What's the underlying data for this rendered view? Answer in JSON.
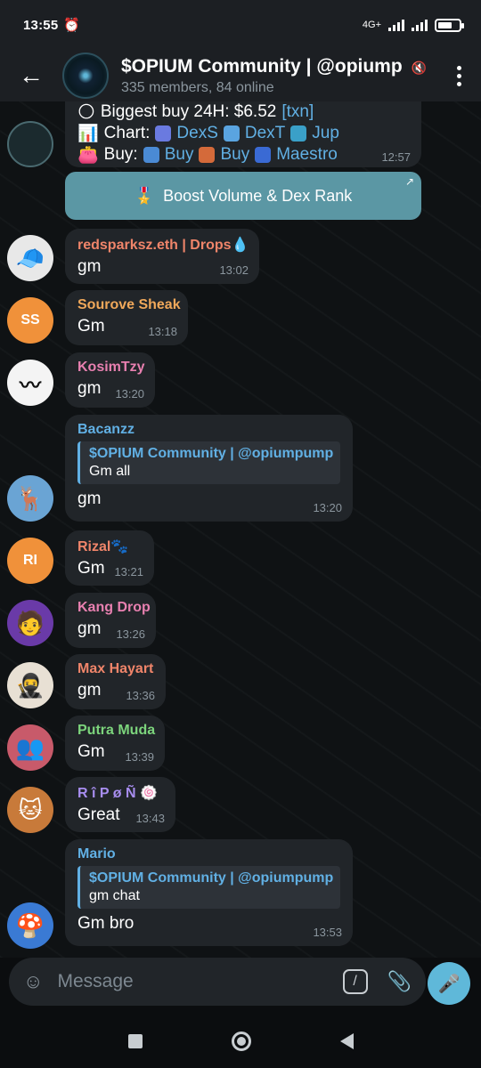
{
  "status_bar": {
    "time": "13:55",
    "network": "4G+"
  },
  "header": {
    "back_label": "←",
    "title": "$OPIUM Community | @opiump",
    "subtitle": "335 members, 84 online"
  },
  "bot_message": {
    "biggest_buy": "Biggest buy 24H: $6.52",
    "txn_link": "[txn]",
    "chart_label": "Chart:",
    "chart_links": [
      "DexS",
      "DexT",
      "Jup"
    ],
    "buy_label": "Buy:",
    "buy_links": [
      "Buy",
      "Buy",
      "Maestro"
    ],
    "time": "12:57"
  },
  "boost_button": {
    "label": "Boost Volume & Dex Rank"
  },
  "messages": [
    {
      "name": "redsparksz.eth | Drops💧",
      "text": "gm",
      "time": "13:02",
      "name_color": "#f0856a",
      "avatar_initials": "",
      "avatar_color": "#e8e8e8"
    },
    {
      "name": "Sourove Sheak",
      "text": "Gm",
      "time": "13:18",
      "name_color": "#f0a85a",
      "avatar_initials": "SS",
      "avatar_color": "#f0913a"
    },
    {
      "name": "KosimTzy",
      "text": "gm",
      "time": "13:20",
      "name_color": "#e880b0",
      "avatar_initials": "",
      "avatar_color": "#f4f4f4"
    },
    {
      "name": "Bacanzz",
      "reply_name": "$OPIUM Community | @opiumpump",
      "reply_text": "Gm all",
      "text": "gm",
      "time": "13:20",
      "name_color": "#61b0e4",
      "avatar_initials": "",
      "avatar_color": "#6aa4d4"
    },
    {
      "name": "Rizal🐾",
      "text": "Gm",
      "time": "13:21",
      "name_color": "#f0856a",
      "avatar_initials": "RI",
      "avatar_color": "#f0913a"
    },
    {
      "name": "Kang Drop",
      "text": "gm",
      "time": "13:26",
      "name_color": "#e880b0",
      "avatar_initials": "",
      "avatar_color": "#6a3aa8"
    },
    {
      "name": "Max Hayart",
      "text": "gm",
      "time": "13:36",
      "name_color": "#f0856a",
      "avatar_initials": "",
      "avatar_color": "#e8e0d4"
    },
    {
      "name": "Putra Muda",
      "text": "Gm",
      "time": "13:39",
      "name_color": "#7cd47c",
      "avatar_initials": "",
      "avatar_color": "#c85a6a"
    },
    {
      "name": "R î P ø Ñ 🍥",
      "text": "Great",
      "time": "13:43",
      "name_color": "#a88ef0",
      "avatar_initials": "",
      "avatar_color": "#c87a3a"
    },
    {
      "name": "Mario",
      "reply_name": "$OPIUM Community | @opiumpump",
      "reply_text": "gm chat",
      "text": "Gm bro",
      "time": "13:53",
      "name_color": "#61b0e4",
      "avatar_initials": "",
      "avatar_color": "#3a7ad4"
    }
  ],
  "composer": {
    "placeholder": "Message"
  },
  "colors": {
    "accent": "#61b0e4",
    "bubble": "#212529",
    "boost": "#5b97a4",
    "mic": "#5fb8d9"
  }
}
